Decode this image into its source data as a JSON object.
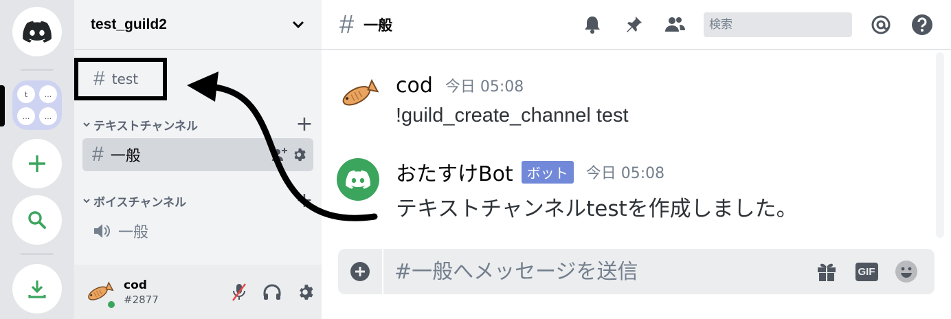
{
  "guild": {
    "name": "test_guild2",
    "folder_initials": [
      "t",
      "...",
      "...",
      "..."
    ]
  },
  "sidebar": {
    "highlight_channel": "test",
    "categories": [
      {
        "label": "テキストチャンネル",
        "channels": [
          {
            "name": "一般",
            "type": "text",
            "active": true
          }
        ]
      },
      {
        "label": "ボイスチャンネル",
        "channels": [
          {
            "name": "一般",
            "type": "voice",
            "active": false
          }
        ]
      }
    ]
  },
  "user": {
    "name": "cod",
    "tag": "#2877",
    "status_color": "#3ba55d"
  },
  "channel": {
    "name": "一般"
  },
  "search": {
    "placeholder": "検索"
  },
  "messages": [
    {
      "author": "cod",
      "timestamp": "今日 05:08",
      "text": "!guild_create_channel test",
      "bot": false
    },
    {
      "author": "おたすけBot",
      "badge": "ボット",
      "timestamp": "今日 05:08",
      "text": "テキストチャンネルtestを作成しました。",
      "bot": true
    }
  ],
  "composer": {
    "placeholder": "#一般へメッセージを送信",
    "gif_label": "GIF"
  },
  "colors": {
    "brand": "#5865f2",
    "green": "#3ba55d",
    "bot_badge": "#7289da",
    "annotation": "#000000"
  },
  "icons": [
    "discord-logo-icon",
    "plus-icon",
    "search-icon",
    "download-icon",
    "chevron-down-icon",
    "bell-icon",
    "pin-icon",
    "members-icon",
    "mention-icon",
    "help-icon",
    "mic-muted-icon",
    "headphones-icon",
    "gear-icon",
    "gift-icon",
    "emoji-icon",
    "speaker-icon",
    "add-member-icon"
  ]
}
